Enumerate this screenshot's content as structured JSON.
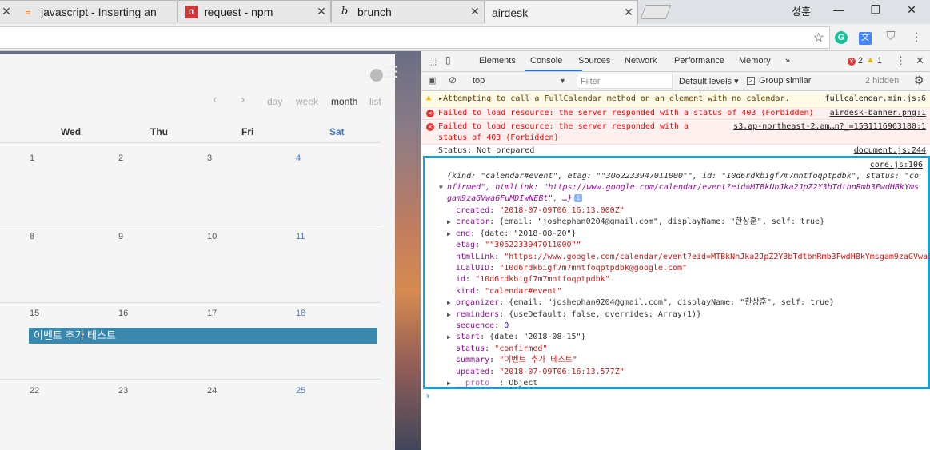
{
  "tabs": [
    {
      "title": "javascript - Inserting an",
      "icon": "stackoverflow-icon"
    },
    {
      "title": "request - npm",
      "icon": "npm-icon"
    },
    {
      "title": "brunch",
      "icon": "brunch-icon"
    },
    {
      "title": "airdesk",
      "icon": "airdesk-icon"
    }
  ],
  "window": {
    "user": "성훈",
    "minimize": "—",
    "restore": "❐",
    "close": "✕"
  },
  "calendar": {
    "nav": {
      "prev": "‹",
      "next": "›",
      "day": "day",
      "week": "week",
      "month": "month",
      "list": "list"
    },
    "days": [
      "Wed",
      "Thu",
      "Fri",
      "Sat"
    ],
    "weeks": [
      [
        "1",
        "2",
        "3",
        "4"
      ],
      [
        "8",
        "9",
        "10",
        "11"
      ],
      [
        "15",
        "16",
        "17",
        "18"
      ],
      [
        "22",
        "23",
        "24",
        "25"
      ]
    ],
    "event": "이벤트 추가 테스트"
  },
  "devtools": {
    "tabs": [
      "Elements",
      "Console",
      "Sources",
      "Network",
      "Performance",
      "Memory",
      "»"
    ],
    "errors": "2",
    "warnings": "1",
    "context": "top",
    "filter_placeholder": "Filter",
    "levels": "Default levels ▾",
    "group_similar": "Group similar",
    "hidden": "2 hidden",
    "messages": {
      "warn": {
        "text": "▸Attempting to call a FullCalendar method on an element with no calendar.",
        "src": "fullcalendar.min.js:6"
      },
      "err1": {
        "text": "Failed to load resource: the server responded with a status of 403 (Forbidden)",
        "src": "airdesk-banner.png:1"
      },
      "err2a": "Failed to load resource: the server responded with a",
      "err2b": "status of 403 (Forbidden)",
      "err2src": "s3.ap-northeast-2.am…n?_=1531116963180:1",
      "status": "Status: Not prepared",
      "statussrc": "document.js:244"
    },
    "object": {
      "src": "core.js:106",
      "summary1": "{kind: \"calendar#event\", etag: \"\"3062233947011000\"\", id: \"10d6rdkbigf7m7mntfoqptpdbk\", status: \"co",
      "summary2": "nfirmed\", htmlLink: \"https://www.google.com/calendar/event?eid=MTBkNnJka2JpZ2Y3bTdtbnRmb3FwdHBkYms",
      "summary3": "gam9zaGVwaGFuMDIwNEBt\", …}",
      "props": [
        {
          "key": "created",
          "val": "\"2018-07-09T06:16:13.000Z\""
        },
        {
          "key": "creator",
          "val": "{email: \"joshephan0204@gmail.com\", displayName: \"한상훈\", self: true}"
        },
        {
          "key": "end",
          "val": "{date: \"2018-08-20\"}"
        },
        {
          "key": "etag",
          "val": "\"\"3062233947011000\"\""
        },
        {
          "key": "htmlLink",
          "val": "\"https://www.google.com/calendar/event?eid=MTBkNnJka2JpZ2Y3bTdtbnRmb3FwdHBkYmsgam9zaGVwaGE"
        },
        {
          "key": "iCalUID",
          "val": "\"10d6rdkbigf7m7mntfoqptpdbk@google.com\""
        },
        {
          "key": "id",
          "val": "\"10d6rdkbigf7m7mntfoqptpdbk\""
        },
        {
          "key": "kind",
          "val": "\"calendar#event\""
        },
        {
          "key": "organizer",
          "val": "{email: \"joshephan0204@gmail.com\", displayName: \"한상훈\", self: true}"
        },
        {
          "key": "reminders",
          "val": "{useDefault: false, overrides: Array(1)}"
        },
        {
          "key": "sequence",
          "val": "0"
        },
        {
          "key": "start",
          "val": "{date: \"2018-08-15\"}"
        },
        {
          "key": "status",
          "val": "\"confirmed\""
        },
        {
          "key": "summary",
          "val": "\"이벤트 추가 테스트\""
        },
        {
          "key": "updated",
          "val": "\"2018-07-09T06:16:13.577Z\""
        },
        {
          "key": "__proto__",
          "val": "Object"
        }
      ]
    },
    "prompt": "›"
  }
}
